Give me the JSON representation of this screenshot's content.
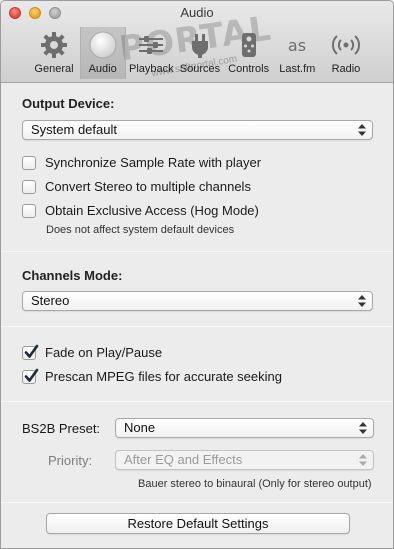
{
  "window": {
    "title": "Audio"
  },
  "toolbar": {
    "items": [
      {
        "label": "General",
        "icon": "gear-icon"
      },
      {
        "label": "Audio",
        "icon": "audio-sphere-icon",
        "selected": true
      },
      {
        "label": "Playback",
        "icon": "playback-sliders-icon"
      },
      {
        "label": "Sources",
        "icon": "plug-icon"
      },
      {
        "label": "Controls",
        "icon": "remote-control-icon"
      },
      {
        "label": "Last.fm",
        "icon": "lastfm-icon"
      },
      {
        "label": "Radio",
        "icon": "radio-waves-icon"
      }
    ]
  },
  "watermark": {
    "logo": "PORTAL",
    "sub": "www.softportal.com"
  },
  "output": {
    "title": "Output Device:",
    "device": "System default",
    "options": [
      {
        "label": "Synchronize Sample Rate with player",
        "checked": false
      },
      {
        "label": "Convert Stereo to multiple channels",
        "checked": false
      },
      {
        "label": "Obtain Exclusive Access (Hog Mode)",
        "checked": false
      }
    ],
    "note": "Does not affect system default devices"
  },
  "channels": {
    "title": "Channels Mode:",
    "mode": "Stereo"
  },
  "playback": {
    "options": [
      {
        "label": "Fade on Play/Pause",
        "checked": true
      },
      {
        "label": "Prescan MPEG files for accurate seeking",
        "checked": true
      }
    ]
  },
  "bs2b": {
    "preset_label": "BS2B Preset:",
    "preset_value": "None",
    "priority_label": "Priority:",
    "priority_value": "After EQ and Effects",
    "note": "Bauer stereo to binaural (Only for stereo output)"
  },
  "restore_label": "Restore Default Settings"
}
